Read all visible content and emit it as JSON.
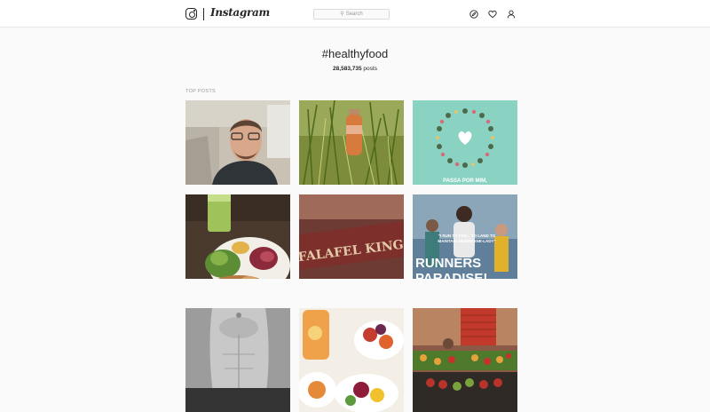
{
  "header": {
    "brand": "Instagram",
    "search_placeholder": "Search",
    "icons": [
      "instagram-glyph-icon",
      "compass-icon",
      "heart-icon",
      "person-icon"
    ]
  },
  "hashtag": {
    "title": "#healthyfood",
    "post_count": "28,583,735",
    "post_suffix": "posts"
  },
  "top_posts_label": "TOP POSTS",
  "posts": {
    "p1": {
      "subject": "man-in-car-selfie"
    },
    "p2": {
      "subject": "bottle-in-grass"
    },
    "p3": {
      "subject": "flower-wreath-heart",
      "caption": "PASSA POR MIM,"
    },
    "p4": {
      "subject": "salad-plate-juice"
    },
    "p5": {
      "subject": "falafel-king-sign",
      "sign_text": "FALAFEL KING"
    },
    "p6": {
      "subject": "runners-paradise",
      "quote_line1": "\"I RUN TO FEEL, TO LAND TO",
      "quote_line2": "MAINTAIN MEMBRANE-LADY\"",
      "headline_line1": "RUNNERS",
      "headline_line2": "PARADISE!"
    },
    "p7": {
      "subject": "abs-torso"
    },
    "p8": {
      "subject": "fruit-bowls"
    },
    "p9": {
      "subject": "fruit-market-stall"
    }
  }
}
